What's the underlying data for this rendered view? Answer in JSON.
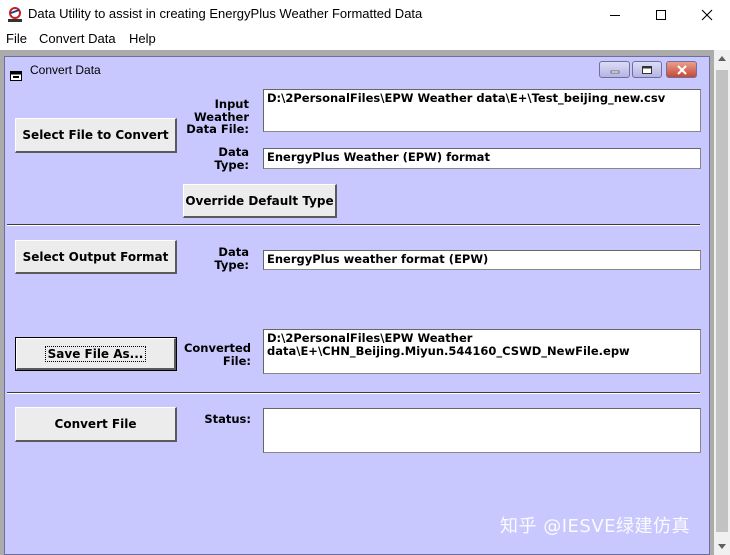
{
  "window": {
    "title": "Data Utility to assist in creating EnergyPlus Weather Formatted Data",
    "icon": "energyplus-logo-icon",
    "controls": [
      "minimize-icon",
      "maximize-icon",
      "close-icon"
    ]
  },
  "menubar": {
    "items": [
      "File",
      "Convert Data",
      "Help"
    ]
  },
  "child_window": {
    "title": "Convert Data"
  },
  "input_section": {
    "select_button": "Select File to Convert",
    "input_label": "Input\nWeather\nData File:",
    "input_value": "D:\\2PersonalFiles\\EPW Weather data\\E+\\Test_beijing_new.csv",
    "type_label": "Data\nType:",
    "type_value": "EnergyPlus Weather (EPW) format",
    "override_button": "Override Default Type"
  },
  "output_section": {
    "select_format_button": "Select Output Format",
    "type_label": "Data\nType:",
    "type_value": "EnergyPlus weather format (EPW)",
    "save_button": "Save File As...",
    "converted_label": "Converted\nFile:",
    "converted_value": "D:\\2PersonalFiles\\EPW Weather data\\E+\\CHN_Beijing.Miyun.544160_CSWD_NewFile.epw"
  },
  "convert_section": {
    "convert_button": "Convert File",
    "status_label": "Status:",
    "status_value": ""
  },
  "watermark": "知乎 @IESVE绿建仿真",
  "colors": {
    "form_background": "#c8c8ff",
    "button_face": "#ececec",
    "field_background": "#ffffff"
  }
}
